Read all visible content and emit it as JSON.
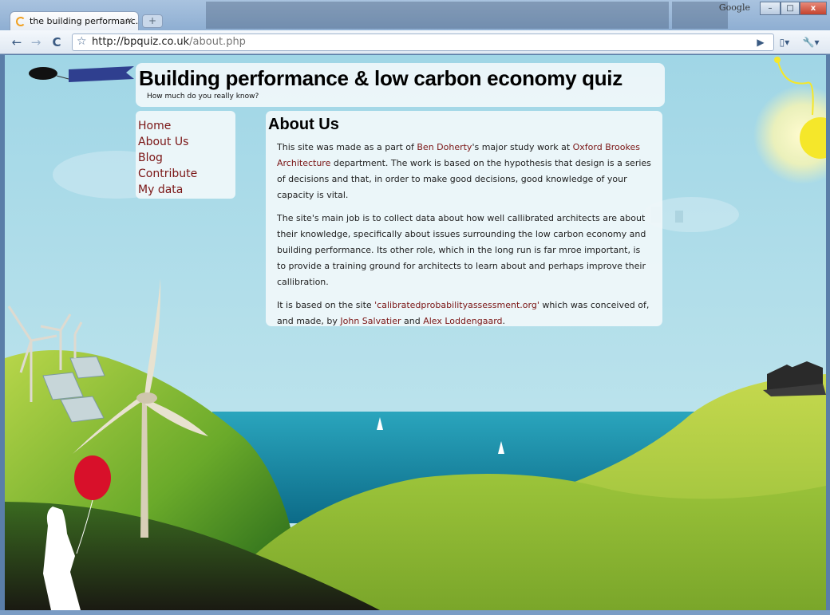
{
  "browser": {
    "tab_title": "the building performanc...",
    "tab_close": "×",
    "new_tab": "+",
    "google_label": "Google",
    "url_host": "http://bpquiz.co.uk",
    "url_path": "/about.php",
    "window_buttons": {
      "minimize": "–",
      "maximize": "□",
      "close": "x"
    },
    "toolbar": {
      "back": "←",
      "forward": "→",
      "reload": "C",
      "go": "▶",
      "page_menu": "▯▾",
      "tools_menu": "🔧▾"
    }
  },
  "site": {
    "title": "Building performance & low carbon economy quiz",
    "tagline": "How much do you really know?"
  },
  "nav": {
    "items": [
      {
        "label": "Home"
      },
      {
        "label": "About Us"
      },
      {
        "label": "Blog"
      },
      {
        "label": "Contribute"
      },
      {
        "label": "My data"
      }
    ]
  },
  "content": {
    "heading": "About Us",
    "p1": {
      "t1": "This site was made as a part of ",
      "link1": "Ben Doherty",
      "t2": "'s major study work at ",
      "link2": "Oxford Brookes Architecture",
      "t3": " department. The work is based on the hypothesis that design is a series of decisions and that, in order to make good decisions, good knowledge of your capacity is vital."
    },
    "p2": "The site's main job is to collect data about how well callibrated architects are about their knowledge, specifically about issues surrounding the low carbon economy and building performance. Its other role, which in the long run is far mroe important, is to provide a training ground for architects to learn about and perhaps improve their callibration.",
    "p3": {
      "t1": "It is based on the site ",
      "link1": "'calibratedprobabilityassessment.org'",
      "t2": " which was conceived of, and made, by ",
      "link2": "John Salvatier",
      "t3": " and ",
      "link3": "Alex Loddengaard",
      "t4": "."
    }
  },
  "colors": {
    "link": "#7a1515",
    "sky": "#a6d8e6",
    "sea": "#137f9c",
    "hill_light": "#9cc43a",
    "hill_dark": "#2d7a1e",
    "balloon": "#d8102a",
    "sun": "#f5e72a"
  }
}
